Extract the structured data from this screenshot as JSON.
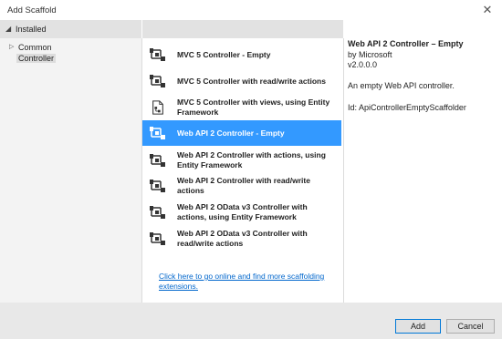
{
  "window": {
    "title": "Add Scaffold",
    "close_icon": "close-icon"
  },
  "left": {
    "header": "Installed",
    "tree": [
      {
        "label": "Common",
        "expandable": true
      },
      {
        "label": "Controller",
        "selected": true
      }
    ]
  },
  "items": [
    {
      "label": "MVC 5 Controller - Empty",
      "icon": "controller-icon"
    },
    {
      "label": "MVC 5 Controller with read/write actions",
      "icon": "controller-icon"
    },
    {
      "label": "MVC 5 Controller with views, using Entity Framework",
      "icon": "controller-views-icon"
    },
    {
      "label": "Web API 2 Controller - Empty",
      "icon": "api-controller-icon",
      "selected": true
    },
    {
      "label": "Web API 2 Controller with actions, using Entity Framework",
      "icon": "controller-icon"
    },
    {
      "label": "Web API 2 Controller with read/write actions",
      "icon": "controller-icon"
    },
    {
      "label": "Web API 2 OData v3 Controller with actions, using Entity Framework",
      "icon": "controller-icon"
    },
    {
      "label": "Web API 2 OData v3 Controller with read/write actions",
      "icon": "controller-icon"
    }
  ],
  "online_link": "Click here to go online and find more scaffolding extensions.",
  "details": {
    "title": "Web API 2 Controller – Empty",
    "author": "by Microsoft",
    "version": "v2.0.0.0",
    "description": "An empty Web API controller.",
    "id": "Id: ApiControllerEmptyScaffolder"
  },
  "buttons": {
    "add": "Add",
    "cancel": "Cancel"
  },
  "colors": {
    "selection": "#3399ff",
    "link": "#0066cc",
    "header_band": "#e2e2e2"
  }
}
